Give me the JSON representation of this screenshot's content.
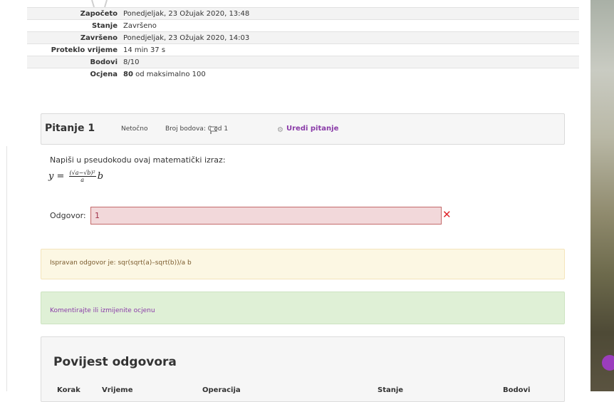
{
  "summary": [
    {
      "label": "Započeto",
      "value": "Ponedjeljak, 23 Ožujak 2020, 13:48"
    },
    {
      "label": "Stanje",
      "value": "Završeno"
    },
    {
      "label": "Završeno",
      "value": "Ponedjeljak, 23 Ožujak 2020, 14:03"
    },
    {
      "label": "Proteklo vrijeme",
      "value": "14 min 37 s"
    },
    {
      "label": "Bodovi",
      "value": "8/10"
    },
    {
      "label": "Ocjena",
      "value_strong": "80",
      "value": " od maksimalno 100"
    }
  ],
  "question": {
    "title": "Pitanje 1",
    "state": "Netočno",
    "points": "Broj bodova: 0 od 1",
    "edit_label": "Uredi pitanje",
    "prompt": "Napiši u pseudokodu ovaj matematički izraz:",
    "answer_label": "Odgovor:",
    "answer_value": "1",
    "icons": {
      "flag": "flag-icon",
      "gear": "gear-icon",
      "incorrect": "cross-icon"
    }
  },
  "feedback": {
    "right_answer": "Ispravan odgovor je: sqr(sqrt(a)–sqrt(b))/a b",
    "comment_link": "Komentirajte ili izmijenite ocjenu"
  },
  "history": {
    "title": "Povijest odgovora",
    "columns": [
      "Korak",
      "Vrijeme",
      "Operacija",
      "Stanje",
      "Bodovi"
    ]
  },
  "colors": {
    "link": "#8a3ba8",
    "error_bg": "#f2d8da",
    "success_bg": "#dff0d6",
    "warning_bg": "#fcf7e3"
  }
}
